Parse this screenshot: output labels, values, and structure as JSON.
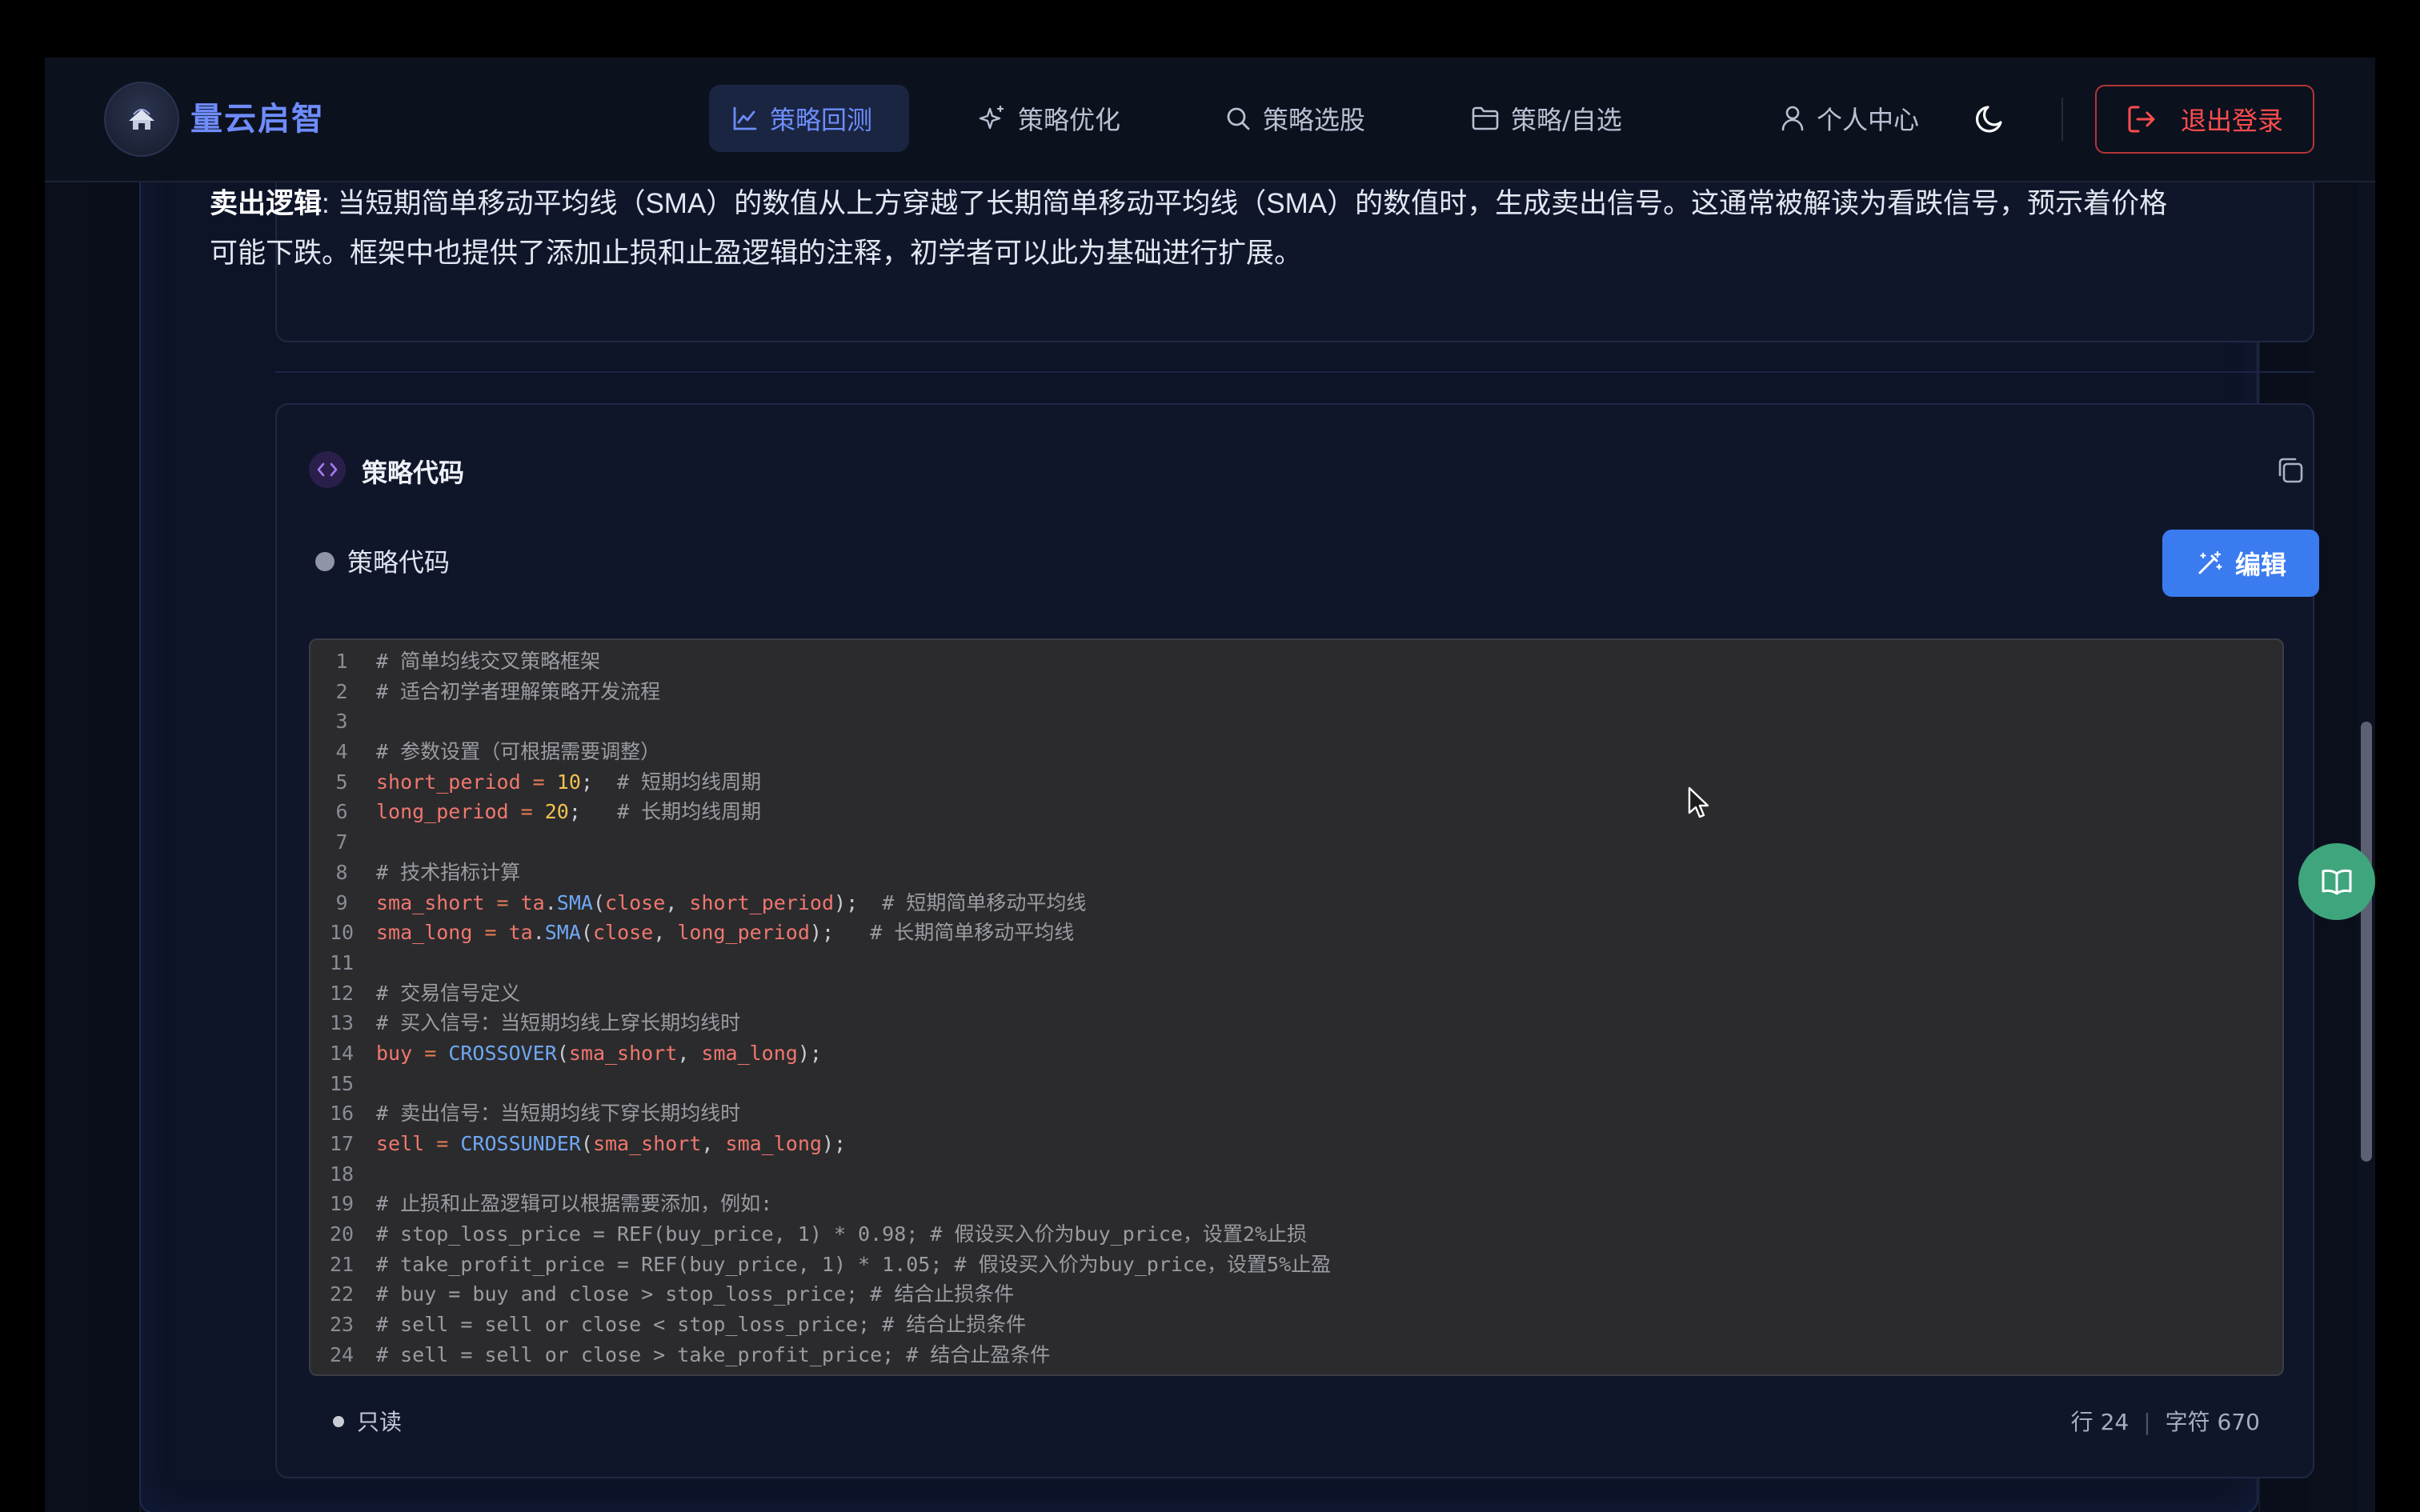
{
  "app": {
    "brand_title": "量云启智",
    "logo_alt": "logo"
  },
  "nav": {
    "items": [
      {
        "label": "策略回测",
        "icon": "line-chart-icon",
        "active": true
      },
      {
        "label": "策略优化",
        "icon": "sparkles-icon",
        "active": false
      },
      {
        "label": "策略选股",
        "icon": "search-icon",
        "active": false
      },
      {
        "label": "策略/自选",
        "icon": "folder-icon",
        "active": false
      },
      {
        "label": "个人中心",
        "icon": "user-icon",
        "active": false
      }
    ],
    "theme_icon": "moon-icon",
    "logout_label": "退出登录"
  },
  "description": {
    "bold_label": "卖出逻辑",
    "text": ": 当短期简单移动平均线（SMA）的数值从上方穿越了长期简单移动平均线（SMA）的数值时，生成卖出信号。这通常被解读为看跌信号，预示着价格可能下跌。框架中也提供了添加止损和止盈逻辑的注释，初学者可以此为基础进行扩展。"
  },
  "code_card": {
    "title": "策略代码",
    "status_label": "策略代码",
    "edit_label": "编辑",
    "footer_mode": "只读",
    "footer_lines": "行 24",
    "footer_chars": "字符 670"
  },
  "code": [
    [
      {
        "t": "# 简单均线交叉策略框架",
        "c": "comment"
      }
    ],
    [
      {
        "t": "# 适合初学者理解策略开发流程",
        "c": "comment"
      }
    ],
    [],
    [
      {
        "t": "# 参数设置（可根据需要调整）",
        "c": "comment"
      }
    ],
    [
      {
        "t": "short_period",
        "c": "var"
      },
      {
        "t": " = ",
        "c": "op"
      },
      {
        "t": "10",
        "c": "num"
      },
      {
        "t": ";  ",
        "c": "punc"
      },
      {
        "t": "# 短期均线周期",
        "c": "comment"
      }
    ],
    [
      {
        "t": "long_period",
        "c": "var"
      },
      {
        "t": " = ",
        "c": "op"
      },
      {
        "t": "20",
        "c": "num"
      },
      {
        "t": ";   ",
        "c": "punc"
      },
      {
        "t": "# 长期均线周期",
        "c": "comment"
      }
    ],
    [],
    [
      {
        "t": "# 技术指标计算",
        "c": "comment"
      }
    ],
    [
      {
        "t": "sma_short",
        "c": "var"
      },
      {
        "t": " = ",
        "c": "op"
      },
      {
        "t": "ta",
        "c": "var"
      },
      {
        "t": ".",
        "c": "punc"
      },
      {
        "t": "SMA",
        "c": "fn"
      },
      {
        "t": "(",
        "c": "punc"
      },
      {
        "t": "close",
        "c": "var"
      },
      {
        "t": ", ",
        "c": "punc"
      },
      {
        "t": "short_period",
        "c": "var"
      },
      {
        "t": ");  ",
        "c": "punc"
      },
      {
        "t": "# 短期简单移动平均线",
        "c": "comment"
      }
    ],
    [
      {
        "t": "sma_long",
        "c": "var"
      },
      {
        "t": " = ",
        "c": "op"
      },
      {
        "t": "ta",
        "c": "var"
      },
      {
        "t": ".",
        "c": "punc"
      },
      {
        "t": "SMA",
        "c": "fn"
      },
      {
        "t": "(",
        "c": "punc"
      },
      {
        "t": "close",
        "c": "var"
      },
      {
        "t": ", ",
        "c": "punc"
      },
      {
        "t": "long_period",
        "c": "var"
      },
      {
        "t": ");   ",
        "c": "punc"
      },
      {
        "t": "# 长期简单移动平均线",
        "c": "comment"
      }
    ],
    [],
    [
      {
        "t": "# 交易信号定义",
        "c": "comment"
      }
    ],
    [
      {
        "t": "# 买入信号：当短期均线上穿长期均线时",
        "c": "comment"
      }
    ],
    [
      {
        "t": "buy",
        "c": "var"
      },
      {
        "t": " = ",
        "c": "op"
      },
      {
        "t": "CROSSOVER",
        "c": "fn"
      },
      {
        "t": "(",
        "c": "punc"
      },
      {
        "t": "sma_short",
        "c": "var"
      },
      {
        "t": ", ",
        "c": "punc"
      },
      {
        "t": "sma_long",
        "c": "var"
      },
      {
        "t": ");",
        "c": "punc"
      }
    ],
    [],
    [
      {
        "t": "# 卖出信号：当短期均线下穿长期均线时",
        "c": "comment"
      }
    ],
    [
      {
        "t": "sell",
        "c": "var"
      },
      {
        "t": " = ",
        "c": "op"
      },
      {
        "t": "CROSSUNDER",
        "c": "fn"
      },
      {
        "t": "(",
        "c": "punc"
      },
      {
        "t": "sma_short",
        "c": "var"
      },
      {
        "t": ", ",
        "c": "punc"
      },
      {
        "t": "sma_long",
        "c": "var"
      },
      {
        "t": ");",
        "c": "punc"
      }
    ],
    [],
    [
      {
        "t": "# 止损和止盈逻辑可以根据需要添加，例如:",
        "c": "comment"
      }
    ],
    [
      {
        "t": "# stop_loss_price = REF(buy_price, 1) * 0.98; # 假设买入价为buy_price，设置2%止损",
        "c": "comment"
      }
    ],
    [
      {
        "t": "# take_profit_price = REF(buy_price, 1) * 1.05; # 假设买入价为buy_price，设置5%止盈",
        "c": "comment"
      }
    ],
    [
      {
        "t": "# buy = buy and close > stop_loss_price; # 结合止损条件",
        "c": "comment"
      }
    ],
    [
      {
        "t": "# sell = sell or close < stop_loss_price; # 结合止损条件",
        "c": "comment"
      }
    ],
    [
      {
        "t": "# sell = sell or close > take_profit_price; # 结合止盈条件",
        "c": "comment"
      }
    ]
  ],
  "fab_icon": "book-open-icon",
  "colors": {
    "accent": "#6d8dff",
    "edit_button": "#3b7bf0",
    "logout": "#ff4d4d",
    "fab": "#3fa57c"
  }
}
